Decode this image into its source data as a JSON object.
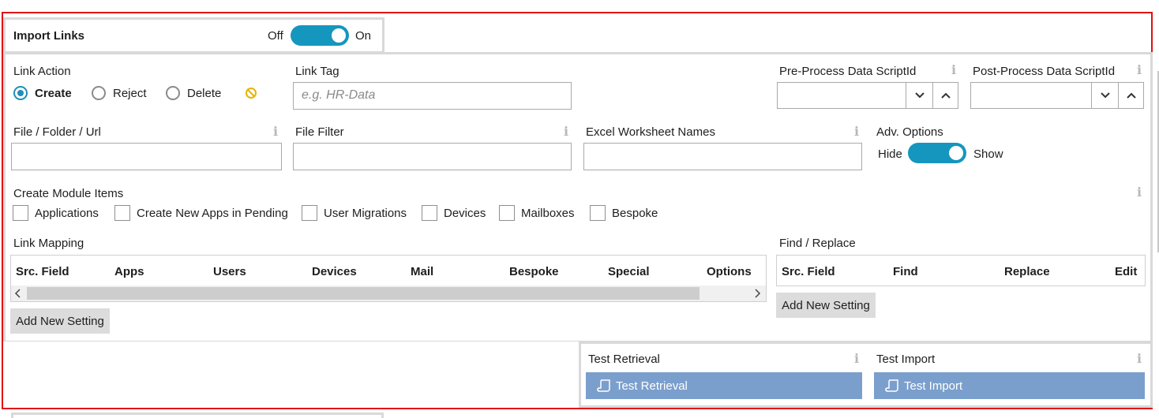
{
  "header": {
    "title": "Import Links",
    "toggle_off": "Off",
    "toggle_on": "On",
    "toggle_value": "On"
  },
  "link_action": {
    "label": "Link Action",
    "options": [
      "Create",
      "Reject",
      "Delete"
    ],
    "selected": "Create",
    "clear_icon": "no-entry-icon"
  },
  "link_tag": {
    "label": "Link Tag",
    "placeholder": "e.g. HR-Data",
    "value": ""
  },
  "pre_process": {
    "label": "Pre-Process Data ScriptId",
    "value": ""
  },
  "post_process": {
    "label": "Post-Process Data ScriptId",
    "value": ""
  },
  "file_folder_url": {
    "label": "File / Folder / Url",
    "value": ""
  },
  "file_filter": {
    "label": "File Filter",
    "value": ""
  },
  "excel_worksheets": {
    "label": "Excel Worksheet Names",
    "value": ""
  },
  "adv_options": {
    "label": "Adv. Options",
    "hide": "Hide",
    "show": "Show",
    "value": "Show"
  },
  "module_items": {
    "label": "Create Module Items",
    "items": [
      "Applications",
      "Create New Apps in Pending",
      "User Migrations",
      "Devices",
      "Mailboxes",
      "Bespoke"
    ]
  },
  "link_mapping": {
    "label": "Link Mapping",
    "columns": [
      "Src. Field",
      "Apps",
      "Users",
      "Devices",
      "Mail",
      "Bespoke",
      "Special",
      "Options"
    ],
    "add_button": "Add New Setting"
  },
  "find_replace": {
    "label": "Find / Replace",
    "columns": [
      "Src. Field",
      "Find",
      "Replace",
      "Edit"
    ],
    "add_button": "Add New Setting"
  },
  "test_retrieval": {
    "label": "Test Retrieval",
    "button": "Test Retrieval"
  },
  "test_import": {
    "label": "Test Import",
    "button": "Test Import"
  },
  "info_icon": "i",
  "colors": {
    "accent": "#1596be",
    "outline": "#e01010",
    "test_button": "#7b9fcd",
    "border": "#d9d9d9"
  }
}
